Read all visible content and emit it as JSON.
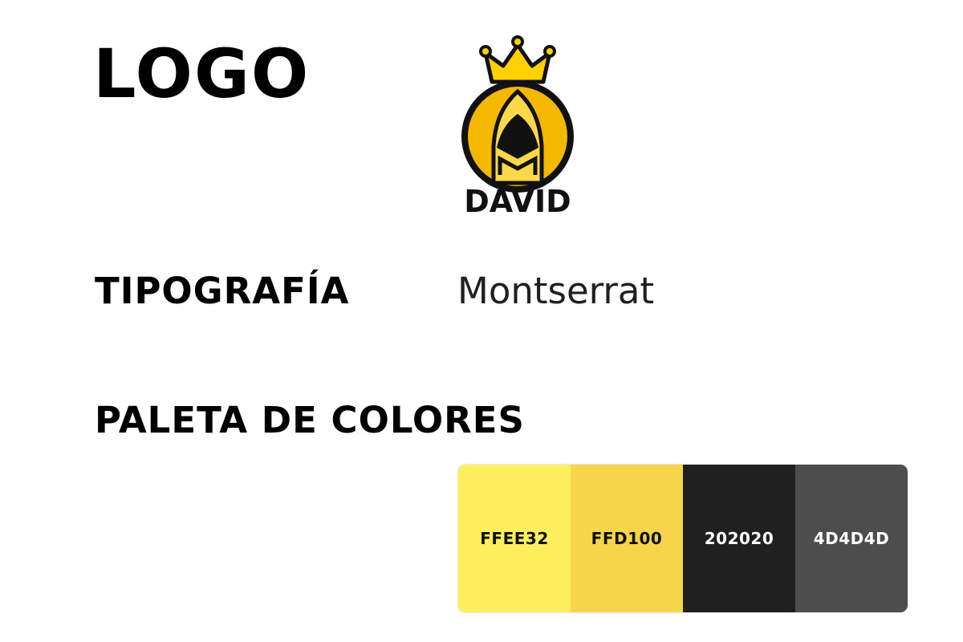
{
  "sections": {
    "logo": {
      "heading": "LOGO",
      "brand_text": "DAVID"
    },
    "typography": {
      "heading": "TIPOGRAFÍA",
      "font_name": "Montserrat"
    },
    "palette": {
      "heading": "PALETA DE COLORES",
      "swatches": [
        {
          "code": "FFEE32",
          "color": "#FCEE5C",
          "text_color": "#111111"
        },
        {
          "code": "FFD100",
          "color": "#F7D54A",
          "text_color": "#111111"
        },
        {
          "code": "202020",
          "color": "#202020",
          "text_color": "#ffffff"
        },
        {
          "code": "4D4D4D",
          "color": "#4D4D4D",
          "text_color": "#ffffff"
        }
      ]
    }
  },
  "logo_colors": {
    "outline": "#111111",
    "gold": "#F5B800",
    "gold_light": "#FFD84A",
    "crown": "#FFD100"
  }
}
